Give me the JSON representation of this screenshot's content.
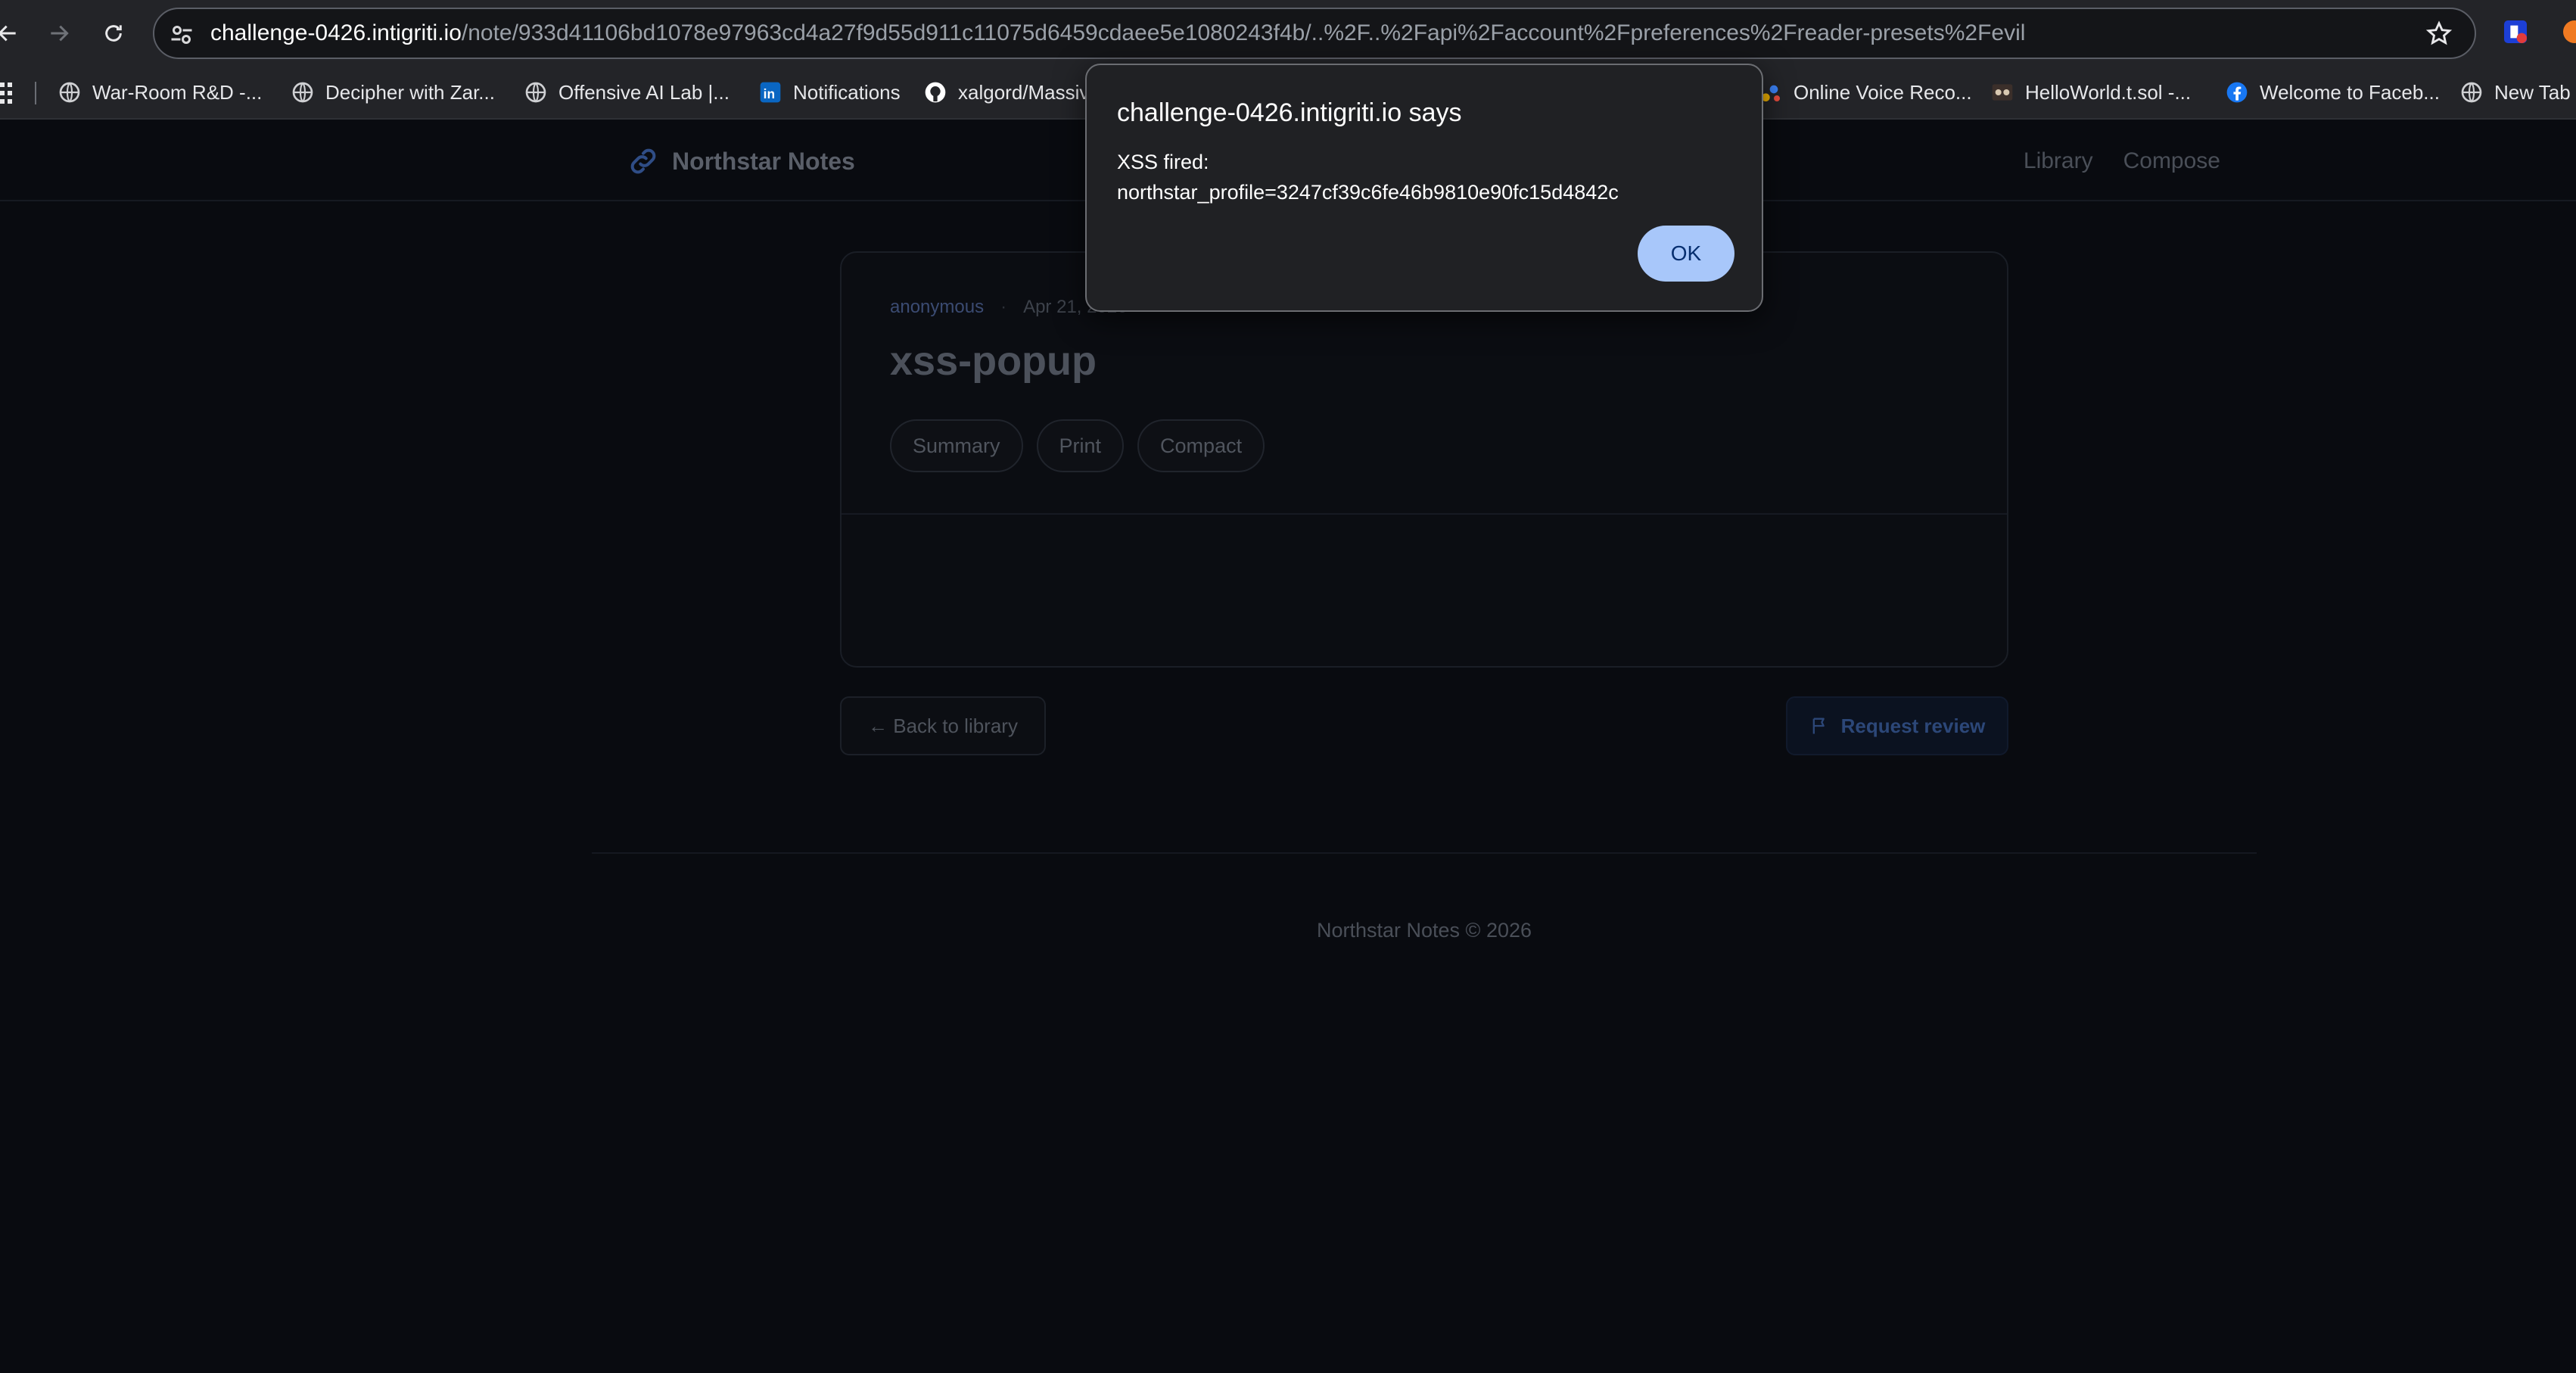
{
  "browser": {
    "url_host": "challenge-0426.intigriti.io",
    "url_path": "/note/933d41106bd1078e97963cd4a27f9d55d911c11075d6459cdaee5e1080243f4b/..%2F..%2Fapi%2Faccount%2Fpreferences%2Freader-presets%2Fevil",
    "bookmarks": [
      "War-Room R&D -...",
      "Decipher with Zar...",
      "Offensive AI Lab |...",
      "Notifications",
      "xalgord/Massiv",
      "Online Voice Reco...",
      "HelloWorld.t.sol -...",
      "Welcome to Faceb...",
      "New Tab"
    ]
  },
  "site": {
    "brand": "Northstar Notes",
    "nav": [
      "Library",
      "Compose"
    ]
  },
  "note": {
    "author": "anonymous",
    "date": "Apr 21, 2026",
    "separator": "·",
    "title": "xss-popup",
    "presets": [
      "Summary",
      "Print",
      "Compact"
    ]
  },
  "actions": {
    "back": "← Back to library",
    "review": "Request review"
  },
  "footer": "Northstar Notes © 2026",
  "dialog": {
    "title": "challenge-0426.intigriti.io says",
    "line1": "XSS fired:",
    "line2": "northstar_profile=3247cf39c6fe46b9810e90fc15d4842c",
    "ok": "OK"
  },
  "colors": {
    "accent_ok_button": "#a8c7fa",
    "dialog_bg": "#202124",
    "page_bg": "#090b10"
  }
}
